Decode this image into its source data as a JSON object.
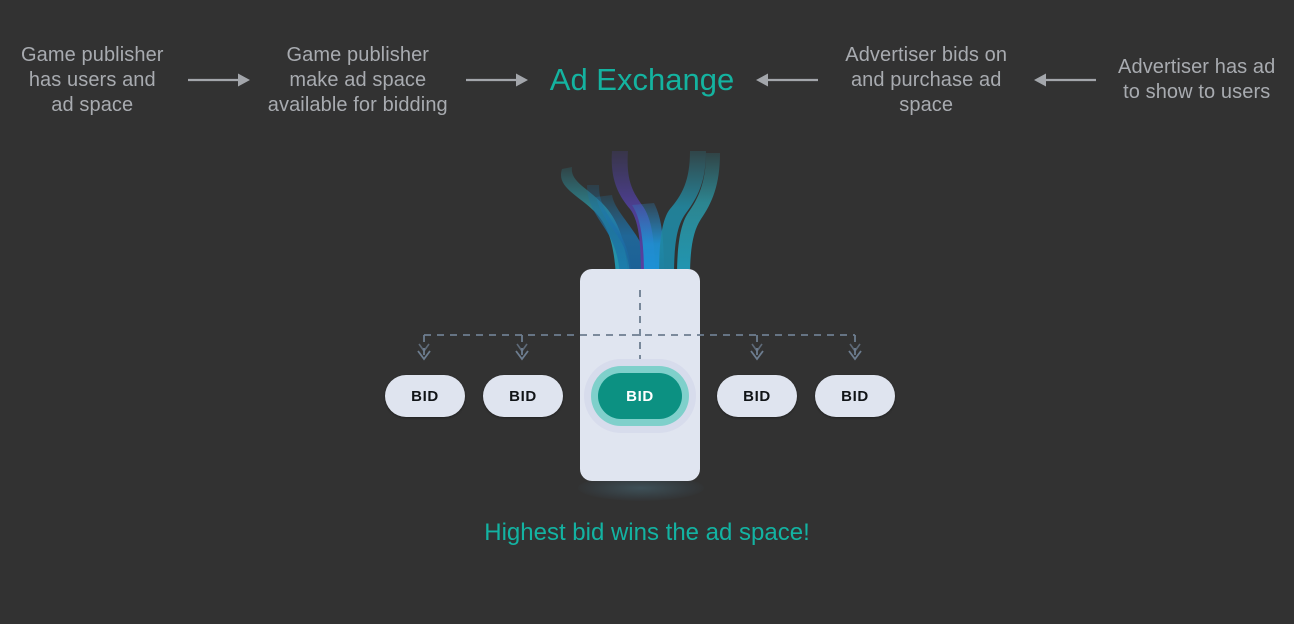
{
  "background_color": "#323232",
  "flow": {
    "steps": [
      {
        "id": "publisher-users",
        "text": "Game publisher\nhas users and\nad space"
      },
      {
        "id": "publisher-bidding",
        "text": "Game publisher\nmake ad space\navailable for bidding"
      },
      {
        "id": "advertiser-bids",
        "text": "Advertiser bids on\nand purchase ad\nspace"
      },
      {
        "id": "advertiser-ad",
        "text": "Advertiser has ad\nto show to users"
      }
    ],
    "hub_title": "Ad Exchange",
    "hub_color": "#14b3a0",
    "label_color": "#a8abb0",
    "arrow_color": "#a3a6ab",
    "arrows": [
      {
        "id": "arrow-1",
        "direction": "right"
      },
      {
        "id": "arrow-2",
        "direction": "right"
      },
      {
        "id": "arrow-3",
        "direction": "left"
      },
      {
        "id": "arrow-4",
        "direction": "left"
      }
    ]
  },
  "auction": {
    "panel_color": "#e0e5f0",
    "dash_color": "#6d7d90",
    "bids": [
      {
        "id": "bid-1",
        "label": "BID",
        "winner": false
      },
      {
        "id": "bid-2",
        "label": "BID",
        "winner": false
      },
      {
        "id": "bid-3",
        "label": "BID",
        "winner": true
      },
      {
        "id": "bid-4",
        "label": "BID",
        "winner": false
      },
      {
        "id": "bid-5",
        "label": "BID",
        "winner": false
      }
    ],
    "winner_color": "#0c9182",
    "winner_ring_inner": "#7fd0cb",
    "winner_ring_outer": "#d7dcec",
    "pill_color": "#dfe4ef",
    "pill_text_color": "#111417"
  },
  "caption": {
    "text": "Highest bid wins the ad space!",
    "color": "#13b3a2"
  },
  "tentacles": {
    "colors": [
      "#2aa8b8",
      "#1e7fb5",
      "#2b87c9",
      "#4b3f8f",
      "#5b3fa0",
      "#2b9bb0",
      "#1c6fa0"
    ]
  }
}
